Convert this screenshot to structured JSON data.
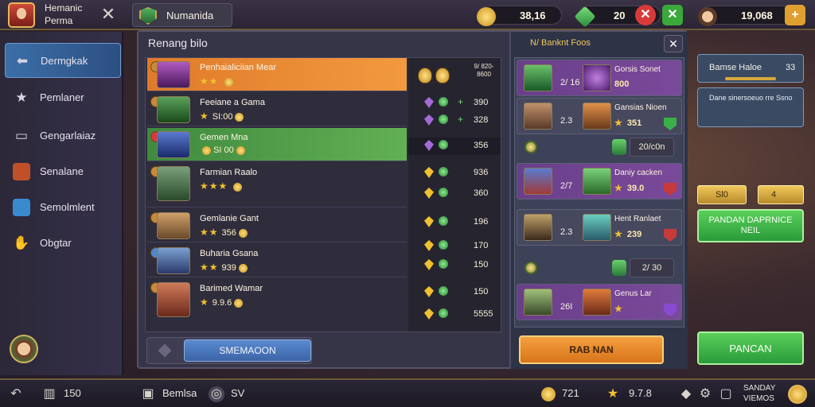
{
  "topbar": {
    "profile_title": "Hemanic Perma",
    "tab_label": "Numanida",
    "resources": [
      {
        "name": "gold",
        "value": "38,16"
      },
      {
        "name": "gems",
        "value": "20"
      },
      {
        "name": "player",
        "value": "19,068"
      }
    ]
  },
  "sidebar": {
    "items": [
      {
        "label": "Dermgkak",
        "icon": "back-arrow-icon"
      },
      {
        "label": "Pemlaner",
        "icon": "star-icon"
      },
      {
        "label": "Gengarlaiaz",
        "icon": "document-icon"
      },
      {
        "label": "Senalane",
        "icon": "hero-face-icon"
      },
      {
        "label": "Semolmlent",
        "icon": "tablet-icon"
      },
      {
        "label": "Obgtar",
        "icon": "hand-icon"
      }
    ]
  },
  "main": {
    "title": "Renang bilo",
    "header_label": "9/ 820-8600",
    "rows": [
      {
        "name": "Penhaialiciian Mear",
        "sub": "",
        "style": "orange",
        "portrait": "#8a3aa0"
      },
      {
        "name": "Feeiane a Gama",
        "sub": "SI:00",
        "style": "plain",
        "portrait": "#3a8a3a"
      },
      {
        "name": "Gemen Mna",
        "sub": "SI 00",
        "style": "green",
        "portrait": "#3a5aa0"
      },
      {
        "name": "Farmian Raalo",
        "sub": "",
        "style": "plain",
        "portrait": "#4a7a4a"
      },
      {
        "name": "Gemlanie Gant",
        "sub": "356",
        "style": "plain",
        "portrait": "#a07a4a"
      },
      {
        "name": "Buharia Gsana",
        "sub": "939",
        "style": "plain",
        "portrait": "#5a7aa0"
      },
      {
        "name": "Barimed Wamar",
        "sub": "9.9.6",
        "style": "plain",
        "portrait": "#a04a3a"
      }
    ],
    "scores": [
      {
        "gem": "purple",
        "value": "390"
      },
      {
        "gem": "purple",
        "value": "328"
      },
      {
        "gem": "purple",
        "value": "356"
      },
      {
        "gem": "yellow",
        "value": "936"
      },
      {
        "gem": "yellow",
        "value": "360"
      },
      {
        "gem": "yellow",
        "value": "196"
      },
      {
        "gem": "yellow",
        "value": "170"
      },
      {
        "gem": "yellow",
        "value": "150"
      },
      {
        "gem": "yellow",
        "value": "150"
      },
      {
        "gem": "yellow",
        "value": "5555"
      }
    ],
    "footer_button": "SMEMAOON"
  },
  "right_panel": {
    "title": "N/ Banknt Foos",
    "cards": [
      {
        "num": "2/ 16",
        "name": "Gorsis Sonet",
        "val": "800",
        "purple": true
      },
      {
        "num": "2.3",
        "name": "Gansias Nioen",
        "val": "351",
        "purple": false
      },
      {
        "num": "2/7",
        "name": "Daniy cacken",
        "val": "39.0",
        "purple": true
      },
      {
        "num": "2.3",
        "name": "Hent Ranlaet",
        "val": "239",
        "purple": false
      },
      {
        "num": "26I",
        "name": "Genus Lar",
        "val": "",
        "purple": true
      }
    ],
    "small_tags": [
      "20/c0n",
      "2/ 30"
    ],
    "action_button": "RAB NAN"
  },
  "side_controls": {
    "stat_label": "Bamse Haloe",
    "stat_value": "33",
    "info_text": "Dane sinersoeuo rre Ssno",
    "gold_left": "Sl0",
    "gold_right": "4",
    "green_button_1": "PANDAN DAPRNICE NEIL",
    "green_button_2": "PANCAN"
  },
  "bottombar": {
    "stat_value": "150",
    "profile_label": "Bemlsa",
    "level": "SV",
    "coins": "721",
    "stars": "9.7.8",
    "right_label": "SANDAY VIEMOS"
  }
}
